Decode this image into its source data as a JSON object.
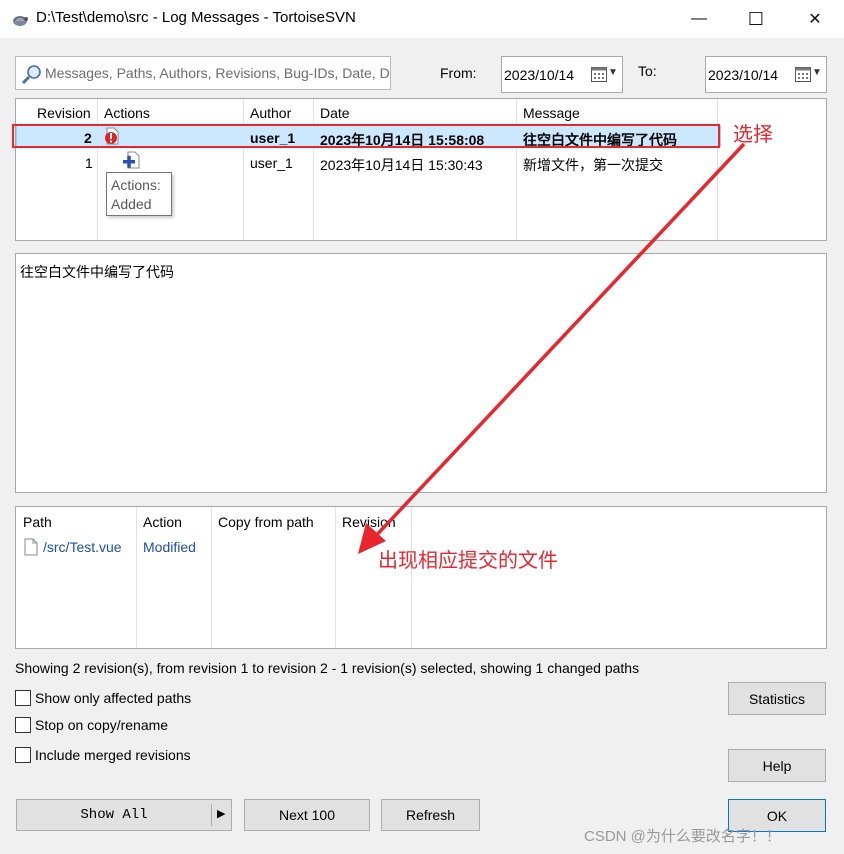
{
  "window": {
    "title": "D:\\Test\\demo\\src - Log Messages - TortoiseSVN",
    "icon": "tortoise-icon",
    "controls": {
      "minimize": "—",
      "maximize": "☐",
      "close": "✕"
    }
  },
  "filter": {
    "search_placeholder": "Messages, Paths, Authors, Revisions, Bug-IDs, Date, D",
    "from_label": "From:",
    "from_value": "2023/10/14",
    "to_label": "To:",
    "to_value": "2023/10/14"
  },
  "log": {
    "columns": [
      "Revision",
      "Actions",
      "Author",
      "Date",
      "Message"
    ],
    "rows": [
      {
        "revision": "2",
        "action_icon": "modified-icon",
        "author": "user_1",
        "date": "2023年10月14日 15:58:08",
        "message": "往空白文件中编写了代码",
        "selected": true
      },
      {
        "revision": "1",
        "action_icon": "added-icon",
        "author": "user_1",
        "date": "2023年10月14日 15:30:43",
        "message": "新增文件，第一次提交",
        "selected": false
      }
    ],
    "tooltip": {
      "line1": "Actions:",
      "line2": "Added"
    }
  },
  "message_text": "往空白文件中编写了代码",
  "paths": {
    "columns": [
      "Path",
      "Action",
      "Copy from path",
      "Revision"
    ],
    "rows": [
      {
        "path": "/src/Test.vue",
        "action": "Modified",
        "copy_from": "",
        "revision": ""
      }
    ]
  },
  "status_text": "Showing 2 revision(s), from revision 1 to revision 2 - 1 revision(s) selected, showing 1 changed paths",
  "options": {
    "affected_paths": "Show only affected paths",
    "stop_on_copy": "Stop on copy/rename",
    "include_merged": "Include merged revisions"
  },
  "buttons": {
    "statistics": "Statistics",
    "help": "Help",
    "show_all": "Show All",
    "next_100": "Next 100",
    "refresh": "Refresh",
    "ok": "OK"
  },
  "annotations": {
    "select_label": "选择",
    "files_label": "出现相应提交的文件",
    "color": "#e8262e"
  },
  "watermark": "CSDN @为什么要改名字！！"
}
